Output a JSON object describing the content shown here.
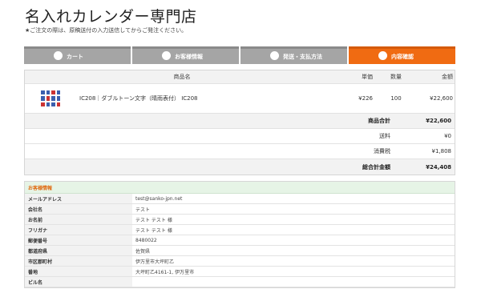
{
  "header": {
    "title": "名入れカレンダー専門店",
    "notice": "★ご注文の際は、原稿送付の入力送信してからご発注ください。"
  },
  "steps": [
    {
      "label": "カート",
      "active": false
    },
    {
      "label": "お客様情報",
      "active": false
    },
    {
      "label": "発送・支払方法",
      "active": false
    },
    {
      "label": "内容確認",
      "active": true
    }
  ],
  "cart": {
    "headers": {
      "name": "商品名",
      "price": "単価",
      "qty": "数量",
      "amount": "金額"
    },
    "items": [
      {
        "name": "IC208｜ダブルトーン文字（晴雨表付） IC208",
        "price": "¥226",
        "qty": "100",
        "amount": "¥22,600"
      }
    ],
    "subtotal": {
      "label": "商品合計",
      "value": "¥22,600"
    },
    "shipping": {
      "label": "送料",
      "value": "¥0"
    },
    "tax": {
      "label": "消費税",
      "value": "¥1,808"
    },
    "total": {
      "label": "総合計金額",
      "value": "¥24,408"
    }
  },
  "customer": {
    "title": "お客様情報",
    "fields": [
      {
        "label": "メールアドレス",
        "value": "test@sanko-jpn.net"
      },
      {
        "label": "会社名",
        "value": "テスト"
      },
      {
        "label": "お名前",
        "value": "テスト テスト 様"
      },
      {
        "label": "フリガナ",
        "value": "テスト テスト 様"
      },
      {
        "label": "郵便番号",
        "value": "8480022"
      },
      {
        "label": "都道府県",
        "value": "佐賀県"
      },
      {
        "label": "市区郡町村",
        "value": "伊万里市大坪町乙"
      },
      {
        "label": "番地",
        "value": "大坪町乙4161-1, 伊万里市"
      },
      {
        "label": "ビル名",
        "value": ""
      }
    ]
  }
}
